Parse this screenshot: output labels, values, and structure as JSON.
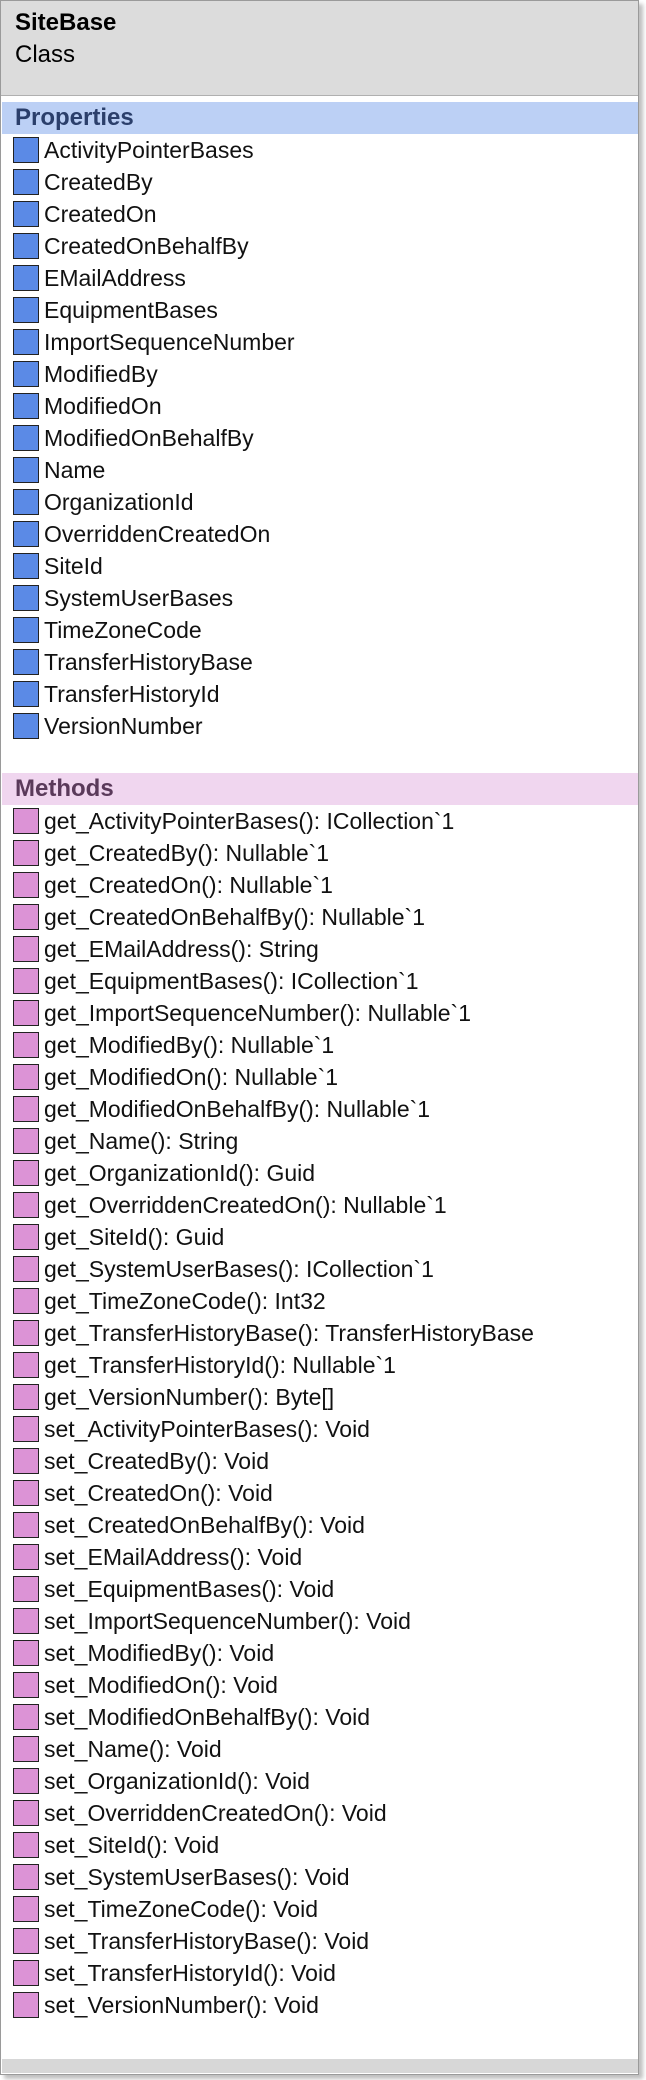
{
  "class": {
    "name": "SiteBase",
    "kind": "Class"
  },
  "colors": {
    "property_swatch": "#5b8ae6",
    "method_swatch": "#dc93d6",
    "properties_header_bg": "#bcd0f5",
    "methods_header_bg": "#f0d6ef"
  },
  "properties": {
    "title": "Properties",
    "items": [
      "ActivityPointerBases",
      "CreatedBy",
      "CreatedOn",
      "CreatedOnBehalfBy",
      "EMailAddress",
      "EquipmentBases",
      "ImportSequenceNumber",
      "ModifiedBy",
      "ModifiedOn",
      "ModifiedOnBehalfBy",
      "Name",
      "OrganizationId",
      "OverriddenCreatedOn",
      "SiteId",
      "SystemUserBases",
      "TimeZoneCode",
      "TransferHistoryBase",
      "TransferHistoryId",
      "VersionNumber"
    ]
  },
  "methods": {
    "title": "Methods",
    "items": [
      "get_ActivityPointerBases(): ICollection`1",
      "get_CreatedBy(): Nullable`1",
      "get_CreatedOn(): Nullable`1",
      "get_CreatedOnBehalfBy(): Nullable`1",
      "get_EMailAddress(): String",
      "get_EquipmentBases(): ICollection`1",
      "get_ImportSequenceNumber(): Nullable`1",
      "get_ModifiedBy(): Nullable`1",
      "get_ModifiedOn(): Nullable`1",
      "get_ModifiedOnBehalfBy(): Nullable`1",
      "get_Name(): String",
      "get_OrganizationId(): Guid",
      "get_OverriddenCreatedOn(): Nullable`1",
      "get_SiteId(): Guid",
      "get_SystemUserBases(): ICollection`1",
      "get_TimeZoneCode(): Int32",
      "get_TransferHistoryBase(): TransferHistoryBase",
      "get_TransferHistoryId(): Nullable`1",
      "get_VersionNumber(): Byte[]",
      "set_ActivityPointerBases(): Void",
      "set_CreatedBy(): Void",
      "set_CreatedOn(): Void",
      "set_CreatedOnBehalfBy(): Void",
      "set_EMailAddress(): Void",
      "set_EquipmentBases(): Void",
      "set_ImportSequenceNumber(): Void",
      "set_ModifiedBy(): Void",
      "set_ModifiedOn(): Void",
      "set_ModifiedOnBehalfBy(): Void",
      "set_Name(): Void",
      "set_OrganizationId(): Void",
      "set_OverriddenCreatedOn(): Void",
      "set_SiteId(): Void",
      "set_SystemUserBases(): Void",
      "set_TimeZoneCode(): Void",
      "set_TransferHistoryBase(): Void",
      "set_TransferHistoryId(): Void",
      "set_VersionNumber(): Void"
    ]
  }
}
